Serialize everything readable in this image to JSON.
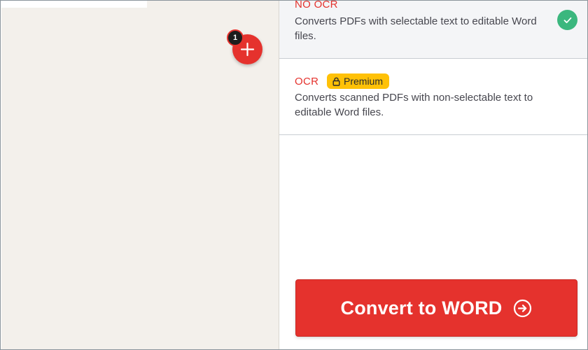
{
  "workspace": {
    "file_count": "1",
    "add_icon": "plus-icon"
  },
  "options": {
    "no_ocr": {
      "title": "NO OCR",
      "description": "Converts PDFs with selectable text to editable Word files.",
      "selected": true,
      "status_icon": "check-circle-icon"
    },
    "ocr": {
      "title": "OCR",
      "badge": "Premium",
      "badge_icon": "lock-icon",
      "description": "Converts scanned PDFs with non-selectable text to editable Word files.",
      "selected": false
    }
  },
  "convert_button": {
    "label": "Convert to WORD",
    "icon": "arrow-right-circle-icon"
  },
  "colors": {
    "accent": "#e5322d",
    "success": "#3bb77e",
    "premium": "#ffc107",
    "workspace_bg": "#f3f0eb"
  }
}
